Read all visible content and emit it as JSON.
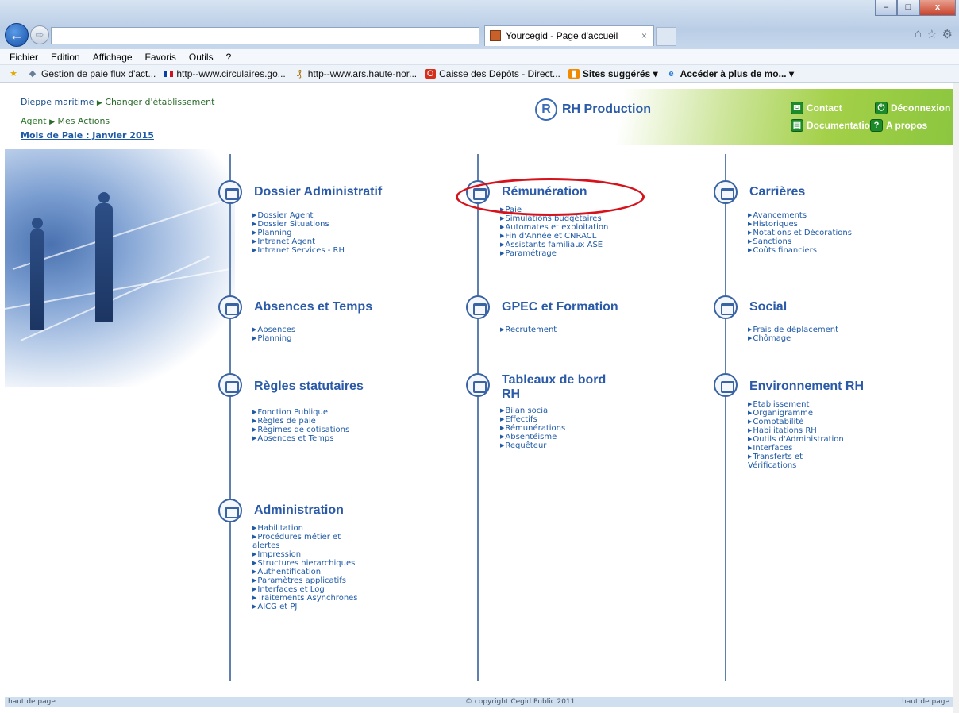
{
  "browser": {
    "tab_title": "Yourcegid - Page d'accueil",
    "tab_close": "×",
    "back_glyph": "←",
    "forward_glyph": "⇨",
    "window_buttons": {
      "minimize": "–",
      "maximize": "□",
      "close": "x"
    },
    "toolbar_icons": [
      "home-icon",
      "star-icon",
      "gear-icon"
    ]
  },
  "menubar": [
    "Fichier",
    "Edition",
    "Affichage",
    "Favoris",
    "Outils",
    "?"
  ],
  "favorites": [
    {
      "label": "Gestion de paie flux d'act...",
      "icon": "tag-icon"
    },
    {
      "label": "http--www.circulaires.go...",
      "icon": "flag-icon"
    },
    {
      "label": "http--www.ars.haute-nor...",
      "icon": "ars-icon"
    },
    {
      "label": "Caisse des Dépôts - Direct...",
      "icon": "caisse-icon"
    },
    {
      "label": "Sites suggérés ▾",
      "icon": "suggested-sites-icon",
      "bold": true
    },
    {
      "label": "Accéder à plus de mo... ▾",
      "icon": "ie-icon",
      "bold": true
    }
  ],
  "header": {
    "establishment": "Dieppe maritime",
    "change_establishment": "Changer d'établissement",
    "agent": "Agent",
    "my_actions": "Mes Actions",
    "pay_month": "Mois de Paie : Janvier 2015",
    "app_name": "RH Production",
    "links": {
      "contact": "Contact",
      "logout": "Déconnexion",
      "documentation": "Documentation",
      "about": "A propos"
    }
  },
  "sections": {
    "dossier": {
      "title": "Dossier Administratif",
      "items": [
        "Dossier Agent",
        "Dossier Situations",
        "Planning",
        "Intranet Agent",
        "Intranet Services - RH"
      ]
    },
    "remuneration": {
      "title": "Rémunération",
      "items": [
        "Paie",
        "Simulations budgétaires",
        "Automates et exploitation",
        "Fin d'Année et CNRACL",
        "Assistants familiaux ASE",
        "Paramétrage"
      ]
    },
    "carrieres": {
      "title": "Carrières",
      "items": [
        "Avancements",
        "Historiques",
        "Notations et Décorations",
        "Sanctions",
        "Coûts financiers"
      ]
    },
    "absences": {
      "title": "Absences et Temps",
      "items": [
        "Absences",
        "Planning"
      ]
    },
    "gpec": {
      "title": "GPEC et Formation",
      "items": [
        "Recrutement"
      ]
    },
    "social": {
      "title": "Social",
      "items": [
        "Frais de déplacement",
        "Chômage"
      ]
    },
    "regles": {
      "title": "Règles statutaires",
      "items": [
        "Fonction Publique",
        "Règles de paie",
        "Régimes de cotisations",
        "Absences et Temps"
      ]
    },
    "tableaux": {
      "title": "Tableaux de bord RH",
      "items": [
        "Bilan social",
        "Effectifs",
        "Rémunérations",
        "Absentéisme",
        "Requêteur"
      ]
    },
    "environnement": {
      "title": "Environnement RH",
      "items": [
        "Etablissement",
        "Organigramme",
        "Comptabilité",
        "Habilitations RH",
        "Outils d'Administration",
        "Interfaces",
        "Transferts et Vérifications"
      ]
    },
    "administration": {
      "title": "Administration",
      "items": [
        "Habilitation",
        "Procédures métier et alertes",
        "Impression",
        "Structures hierarchiques",
        "Authentification",
        "Paramètres applicatifs",
        "Interfaces et Log",
        "Traitements Asynchrones",
        "AICG et PJ"
      ]
    }
  },
  "footer": {
    "left": "haut de page",
    "center": "© copyright Cegid Public 2011",
    "right": "haut de page"
  },
  "colors": {
    "link_blue": "#1f5aa6",
    "title_blue": "#2b5ba8",
    "header_green": "#8cc63f",
    "highlight_red": "#d6131c"
  }
}
